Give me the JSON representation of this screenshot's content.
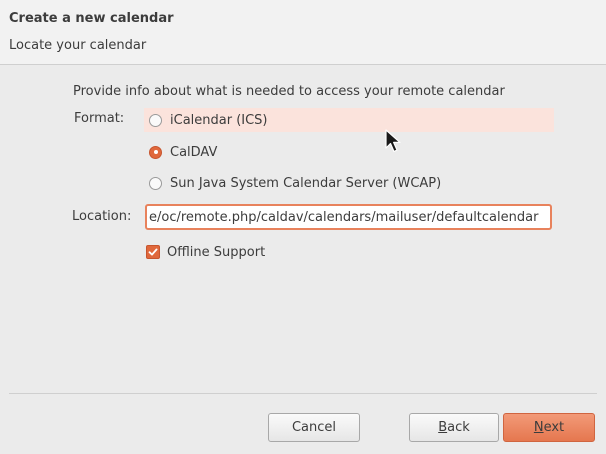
{
  "header": {
    "title": "Create a new calendar",
    "subtitle": "Locate your calendar"
  },
  "form": {
    "intro": "Provide info about what is needed to access your remote calendar",
    "format_label": "Format:",
    "format_options": [
      {
        "label": "iCalendar (ICS)",
        "checked": false
      },
      {
        "label": "CalDAV",
        "checked": true
      },
      {
        "label": "Sun Java System Calendar Server (WCAP)",
        "checked": false
      }
    ],
    "location_label": "Location:",
    "location_value": "e/oc/remote.php/caldav/calendars/mailuser/defaultcalendar",
    "offline_label": "Offline Support",
    "offline_checked": true
  },
  "buttons": {
    "cancel": "Cancel",
    "back_mnemonic": "B",
    "back_rest": "ack",
    "next_mnemonic": "N",
    "next_rest": "ext"
  },
  "colors": {
    "accent": "#e0683c",
    "hover_row": "#fbe3dc",
    "focus_border": "#e8825c"
  }
}
